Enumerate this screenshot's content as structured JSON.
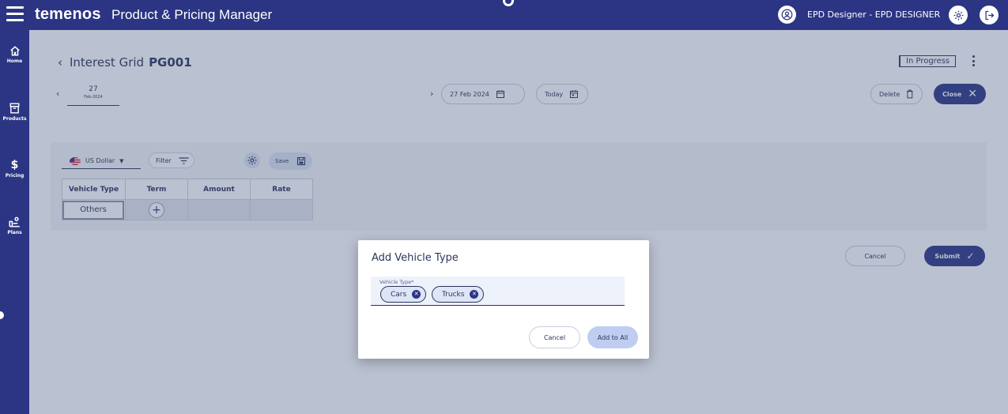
{
  "header": {
    "brand": "temenos",
    "app_title": "Product & Pricing Manager",
    "user_name": "EPD Designer - EPD DESIGNER"
  },
  "sidebar": {
    "items": [
      {
        "label": "Home",
        "icon": "home-icon"
      },
      {
        "label": "Products",
        "icon": "products-icon"
      },
      {
        "label": "Pricing",
        "icon": "dollar-icon"
      },
      {
        "label": "Plans",
        "icon": "plans-icon"
      }
    ]
  },
  "page": {
    "title": "Interest Grid",
    "code": "PG001",
    "status": "In Progress"
  },
  "date_nav": {
    "day": "27",
    "month_year": "Feb-2024",
    "date_value": "27 Feb 2024",
    "today_label": "Today"
  },
  "actions": {
    "delete_label": "Delete",
    "close_label": "Close"
  },
  "grid": {
    "currency": "US Dollar",
    "filter_label": "Filter",
    "save_label": "Save",
    "columns": [
      "Vehicle Type",
      "Term",
      "Amount",
      "Rate"
    ],
    "rows": [
      {
        "vehicle_type": "Others"
      }
    ]
  },
  "footer_actions": {
    "cancel_label": "Cancel",
    "submit_label": "Submit"
  },
  "dialog": {
    "title": "Add Vehicle Type",
    "field_label": "Vehicle Type*",
    "chips": [
      "Cars",
      "Trucks"
    ],
    "cancel_label": "Cancel",
    "add_label": "Add to All"
  },
  "colors": {
    "primary": "#2b3583",
    "overlay": "#40547c",
    "chip_bg": "#dde5f7",
    "add_button_bg": "#bfcdf1"
  }
}
